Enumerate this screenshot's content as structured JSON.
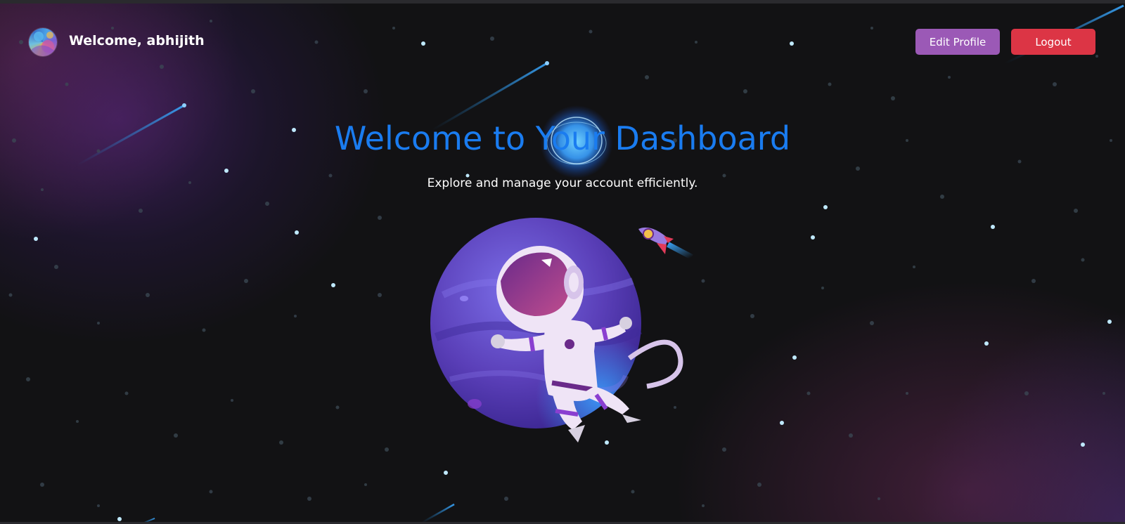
{
  "header": {
    "welcome_text": "Welcome, abhijith",
    "edit_profile_label": "Edit Profile",
    "logout_label": "Logout"
  },
  "hero": {
    "title": "Welcome to Your Dashboard",
    "subtitle": "Explore and manage your account efficiently."
  },
  "colors": {
    "background": "#121214",
    "title": "#1a7cf0",
    "edit_button": "#9b59b6",
    "logout_button": "#dc3545",
    "star": "#bfe9ff"
  },
  "icons": {
    "avatar": "user-avatar-image",
    "illustration": "astronaut-planet-illustration",
    "rocket": "rocket-icon",
    "orb": "glowing-orb-icon"
  }
}
